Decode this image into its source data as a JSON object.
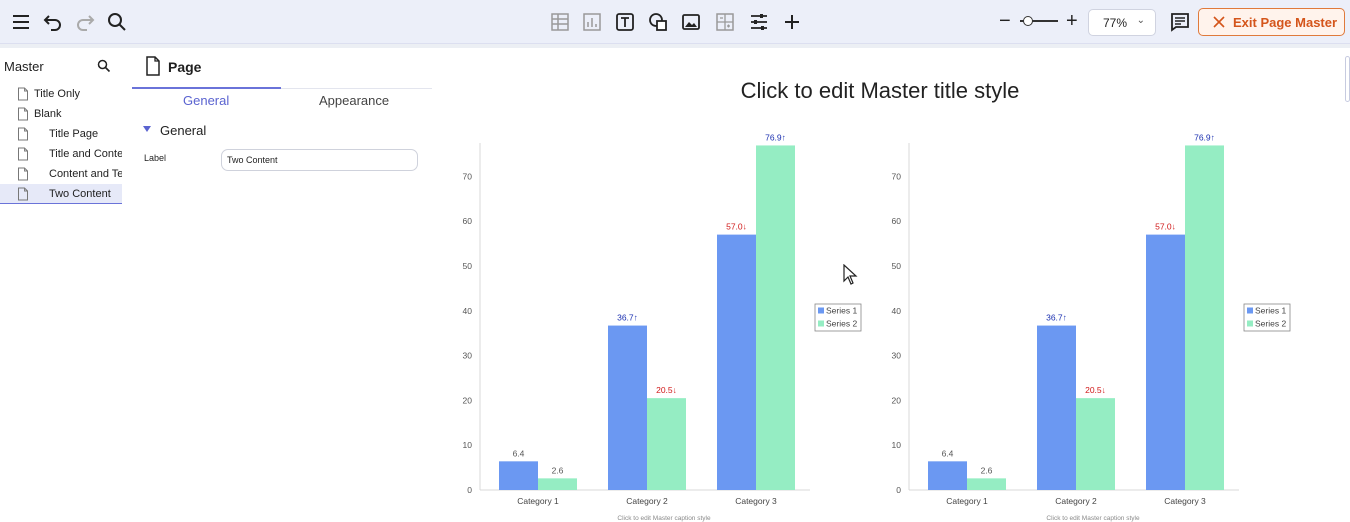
{
  "toolbar": {
    "left_icons": [
      "hamburger-menu-icon",
      "undo-icon",
      "redo-icon",
      "search-icon"
    ],
    "insert_icons": [
      "table-icon",
      "chart-icon",
      "text-box-icon",
      "shapes-icon",
      "image-icon",
      "formula-icon",
      "sliders-icon",
      "plus-icon"
    ],
    "zoom_value": "77%",
    "zoom_level": 0.2,
    "exit_label": "Exit Page Master",
    "accent": "#d4551b"
  },
  "master": {
    "title": "Master",
    "layouts": [
      {
        "label": "Title Only",
        "indent": 0,
        "selected": false
      },
      {
        "label": "Blank",
        "indent": 0,
        "selected": false
      },
      {
        "label": "Title Page",
        "indent": 1,
        "selected": false
      },
      {
        "label": "Title and Content",
        "indent": 1,
        "selected": false
      },
      {
        "label": "Content and Text",
        "indent": 1,
        "selected": false
      },
      {
        "label": "Two Content",
        "indent": 1,
        "selected": true
      }
    ]
  },
  "props": {
    "title": "Page",
    "tabs": [
      "General",
      "Appearance"
    ],
    "section": "General",
    "label_caption": "Label",
    "label_value": "Two Content"
  },
  "slide": {
    "title": "Click to edit Master title style",
    "caption": "Click to edit Master caption style"
  },
  "chart_data": [
    {
      "type": "bar",
      "categories": [
        "Category 1",
        "Category 2",
        "Category 3"
      ],
      "series": [
        {
          "name": "Series 1",
          "values": [
            6.4,
            36.7,
            57.0
          ],
          "labels": [
            "6.4",
            "36.7↑",
            "57.0↓"
          ],
          "color": "#6b98f2"
        },
        {
          "name": "Series 2",
          "values": [
            2.6,
            20.5,
            76.9
          ],
          "labels": [
            "2.6",
            "20.5↓",
            "76.9↑"
          ],
          "color": "#95edc3"
        }
      ],
      "ylim": [
        0,
        77
      ],
      "yticks": [
        "0",
        "10",
        "20",
        "30",
        "40",
        "50",
        "60",
        "70"
      ],
      "legend": "right",
      "grid": false,
      "caption": "Click to edit Master caption style"
    },
    {
      "type": "bar",
      "categories": [
        "Category 1",
        "Category 2",
        "Category 3"
      ],
      "series": [
        {
          "name": "Series 1",
          "values": [
            6.4,
            36.7,
            57.0
          ],
          "labels": [
            "6.4",
            "36.7↑",
            "57.0↓"
          ],
          "color": "#6b98f2"
        },
        {
          "name": "Series 2",
          "values": [
            2.6,
            20.5,
            76.9
          ],
          "labels": [
            "2.6",
            "20.5↓",
            "76.9↑"
          ],
          "color": "#95edc3"
        }
      ],
      "ylim": [
        0,
        77
      ],
      "yticks": [
        "0",
        "10",
        "20",
        "30",
        "40",
        "50",
        "60",
        "70"
      ],
      "legend": "right",
      "grid": false,
      "caption": "Click to edit Master caption style"
    }
  ]
}
